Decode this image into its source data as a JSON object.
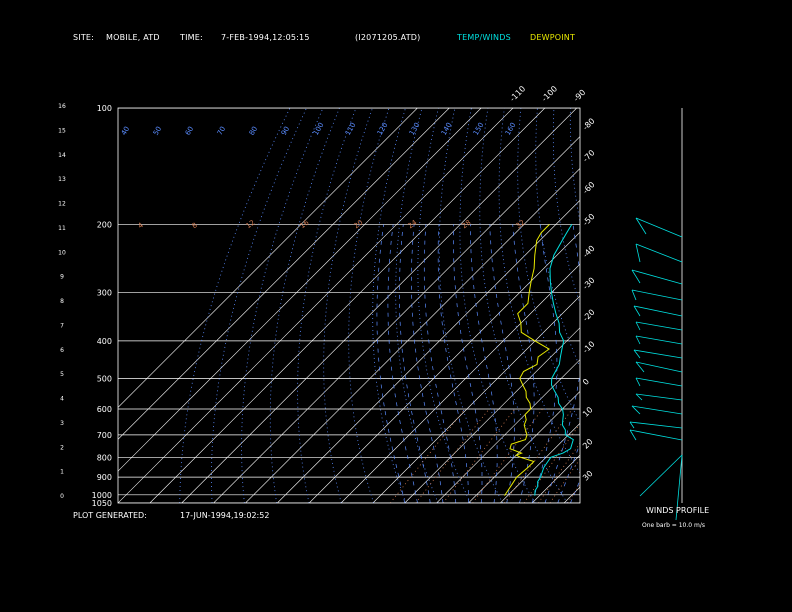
{
  "header": {
    "site_label": "SITE:",
    "site_value": "MOBILE, ATD",
    "time_label": "TIME:",
    "time_value": "7-FEB-1994,12:05:15",
    "file": "(I2071205.ATD)",
    "temp_legend": "TEMP/WINDS",
    "dew_legend": "DEWPOINT"
  },
  "footer": {
    "label": "PLOT GENERATED:",
    "value": "17-JUN-1994,19:02:52"
  },
  "wind_panel": {
    "title": "WINDS PROFILE",
    "subtitle": "One barb = 10.0 m/s"
  },
  "colors": {
    "background": "#000000",
    "temperature": "#00e0e0",
    "dewpoint": "#e8e800",
    "isotherm": "#ffffff",
    "isobar": "#ffffff",
    "dry_adiabat": "#5a8cff",
    "moist_adiabat": "#5a8cff",
    "mixing_ratio": "#d07a50",
    "text": "#ffffff"
  },
  "chart_data": {
    "type": "line",
    "title": "",
    "pressure_levels_hpa": [
      "100",
      "200",
      "300",
      "400",
      "500",
      "600",
      "700",
      "800",
      "900",
      "1000",
      "1050"
    ],
    "height_km_labels": [
      "0",
      "1",
      "2",
      "3",
      "4",
      "5",
      "6",
      "7",
      "8",
      "9",
      "10",
      "11",
      "12",
      "13",
      "14",
      "15",
      "16"
    ],
    "isotherm_labels_c": [
      "-110",
      "-100",
      "-90",
      "-80",
      "-70",
      "-60",
      "-50",
      "-40",
      "-30",
      "-20",
      "-10",
      "0",
      "10",
      "20",
      "30"
    ],
    "dry_adiabat_labels": [
      "40",
      "50",
      "60",
      "70",
      "80",
      "90",
      "100",
      "110",
      "120",
      "130",
      "140",
      "150",
      "160"
    ],
    "mixing_ratio_labels": [
      "4",
      "8",
      "12",
      "16",
      "20",
      "24",
      "28",
      "32"
    ],
    "temp_axis_range_c": [
      -110,
      35
    ],
    "pressure_axis_range_hpa": [
      100,
      1050
    ],
    "log_pressure_axis": true,
    "grid": true,
    "series": [
      {
        "name": "TEMP/WINDS",
        "points": [
          [
            1005,
            18.5
          ],
          [
            975,
            17
          ],
          [
            950,
            16.5
          ],
          [
            925,
            15
          ],
          [
            900,
            14.5
          ],
          [
            875,
            13.5
          ],
          [
            850,
            12.5
          ],
          [
            825,
            12
          ],
          [
            800,
            11.5
          ],
          [
            780,
            14
          ],
          [
            760,
            15
          ],
          [
            740,
            14
          ],
          [
            720,
            13
          ],
          [
            700,
            9
          ],
          [
            680,
            7.5
          ],
          [
            660,
            5
          ],
          [
            640,
            3.5
          ],
          [
            620,
            2
          ],
          [
            600,
            0
          ],
          [
            580,
            -3
          ],
          [
            560,
            -5
          ],
          [
            540,
            -8
          ],
          [
            520,
            -11
          ],
          [
            500,
            -13
          ],
          [
            480,
            -14
          ],
          [
            460,
            -15
          ],
          [
            440,
            -17
          ],
          [
            420,
            -19
          ],
          [
            400,
            -21
          ],
          [
            380,
            -25
          ],
          [
            360,
            -28
          ],
          [
            340,
            -32
          ],
          [
            320,
            -36
          ],
          [
            300,
            -40
          ],
          [
            280,
            -44
          ],
          [
            260,
            -48
          ],
          [
            240,
            -51
          ],
          [
            220,
            -53
          ],
          [
            210,
            -54
          ],
          [
            200,
            -55
          ]
        ]
      },
      {
        "name": "DEWPOINT",
        "points": [
          [
            1005,
            9
          ],
          [
            950,
            8
          ],
          [
            900,
            7
          ],
          [
            850,
            7.5
          ],
          [
            820,
            7.5
          ],
          [
            800,
            2
          ],
          [
            790,
            0
          ],
          [
            780,
            1
          ],
          [
            760,
            -4
          ],
          [
            740,
            -5
          ],
          [
            720,
            -2
          ],
          [
            700,
            -3
          ],
          [
            680,
            -5
          ],
          [
            660,
            -7
          ],
          [
            640,
            -8
          ],
          [
            620,
            -10
          ],
          [
            600,
            -10
          ],
          [
            580,
            -12
          ],
          [
            560,
            -15
          ],
          [
            540,
            -17
          ],
          [
            520,
            -20
          ],
          [
            500,
            -23
          ],
          [
            480,
            -24
          ],
          [
            460,
            -22
          ],
          [
            440,
            -24
          ],
          [
            420,
            -23
          ],
          [
            400,
            -30
          ],
          [
            380,
            -37
          ],
          [
            360,
            -40
          ],
          [
            340,
            -44
          ],
          [
            320,
            -44
          ],
          [
            300,
            -47
          ],
          [
            280,
            -50
          ],
          [
            260,
            -53
          ],
          [
            240,
            -57
          ],
          [
            220,
            -61
          ],
          [
            210,
            -62
          ],
          [
            200,
            -62
          ]
        ]
      }
    ]
  }
}
